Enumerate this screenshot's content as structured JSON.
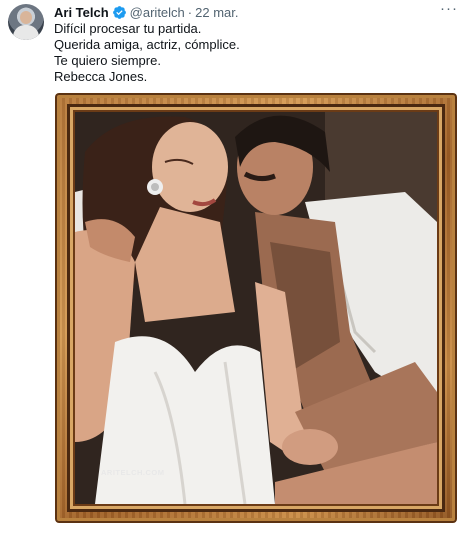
{
  "author": {
    "display_name": "Ari Telch",
    "handle": "@aritelch",
    "date": "22 mar.",
    "separator": "·",
    "verified": true,
    "avatar_icon": "user-avatar"
  },
  "more_label": "···",
  "tweet_lines": [
    "Difícil procesar tu partida.",
    "Querida amiga, actriz, cómplice.",
    "Te quiero siempre.",
    "Rebecca Jones."
  ],
  "media": {
    "watermark": "ARITELCH.COM",
    "frame_style": "wooden-frame"
  },
  "colors": {
    "verified_blue": "#1d9bf0",
    "secondary_text": "#536471",
    "primary_text": "#0f1419"
  }
}
